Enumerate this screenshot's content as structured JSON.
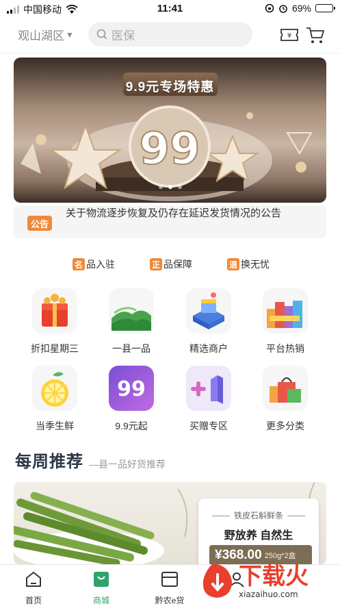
{
  "status_bar": {
    "carrier": "中国移动",
    "time": "11:41",
    "battery": "69%",
    "battery_level": 0.69
  },
  "header": {
    "location": "观山湖区",
    "search_placeholder": "医保",
    "coupon_icon": "coupon-yuan-icon",
    "cart_icon": "cart-icon"
  },
  "banner": {
    "title": "9.9元专场特惠",
    "big_number": "99",
    "slide_count": 3,
    "active_slide": 2
  },
  "notice": {
    "badge": "公告",
    "text": "关于物流逐步恢复及仍存在延迟发货情况的公告"
  },
  "guarantees": [
    {
      "tag": "名",
      "label": "品入驻"
    },
    {
      "tag": "正",
      "label": "品保障"
    },
    {
      "tag": "退",
      "label": "换无忧"
    }
  ],
  "categories": [
    {
      "label": "折扣星期三",
      "icon": "red-gift-box-icon"
    },
    {
      "label": "一县一品",
      "icon": "tea-field-icon"
    },
    {
      "label": "精选商户",
      "icon": "storefront-icon"
    },
    {
      "label": "平台热销",
      "icon": "shopping-city-icon"
    },
    {
      "label": "当季生鲜",
      "icon": "lemon-icon"
    },
    {
      "label": "9.9元起",
      "icon": "ninety-nine-icon"
    },
    {
      "label": "买赠专区",
      "icon": "plus-one-icon"
    },
    {
      "label": "更多分类",
      "icon": "shopping-bag-icon"
    }
  ],
  "weekly": {
    "title": "每周推荐",
    "subtitle": "—县一品好货推荐",
    "product": {
      "name": "铁皮石斛鲜条",
      "slogan": "野放养 自然生",
      "price": "¥368.00",
      "spec": "250g*2盒"
    }
  },
  "tabbar": [
    {
      "label": "首页",
      "icon": "home-icon",
      "active": false
    },
    {
      "label": "商城",
      "icon": "shopping-bag-icon",
      "active": true
    },
    {
      "label": "黔农e贷",
      "icon": "card-icon",
      "active": false
    },
    {
      "label": "",
      "icon": "user-icon",
      "active": false
    }
  ],
  "watermark": {
    "text": "下载火",
    "url": "xiazaihuo.com"
  },
  "colors": {
    "accent_orange": "#f08a3a",
    "active_green": "#2ea46a",
    "title_navy": "#2b3648"
  }
}
